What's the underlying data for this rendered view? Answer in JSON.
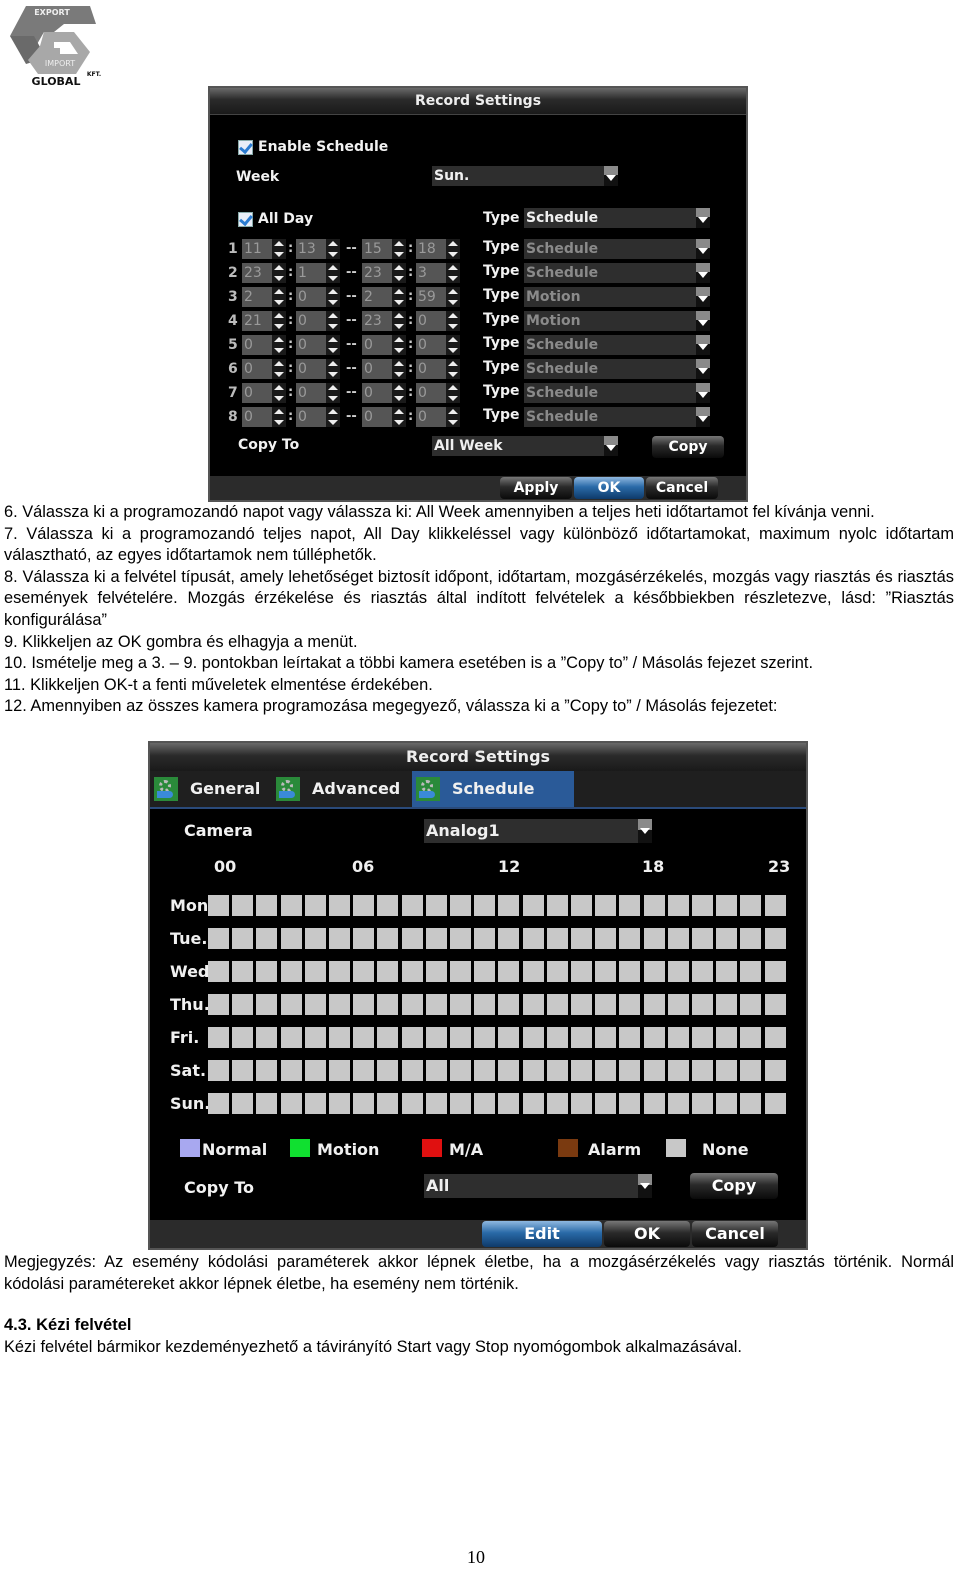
{
  "logo": {
    "top_text": "EXPORT",
    "mid_text": "IMPORT",
    "brand": "GLOBAL",
    "suffix": "KFT."
  },
  "panel1": {
    "title": "Record Settings",
    "enable_schedule": {
      "label": "Enable Schedule",
      "checked": true
    },
    "week": {
      "label": "Week",
      "value": "Sun."
    },
    "all_day": {
      "label": "All Day",
      "checked": true
    },
    "type_label": "Type",
    "all_day_type": "Schedule",
    "rows": [
      {
        "num": "1",
        "start_h": "11",
        "start_m": "13",
        "end_h": "15",
        "end_m": "18",
        "type": "Schedule"
      },
      {
        "num": "2",
        "start_h": "23",
        "start_m": "1",
        "end_h": "23",
        "end_m": "3",
        "type": "Schedule"
      },
      {
        "num": "3",
        "start_h": "2",
        "start_m": "0",
        "end_h": "2",
        "end_m": "59",
        "type": "Motion"
      },
      {
        "num": "4",
        "start_h": "21",
        "start_m": "0",
        "end_h": "23",
        "end_m": "0",
        "type": "Motion"
      },
      {
        "num": "5",
        "start_h": "0",
        "start_m": "0",
        "end_h": "0",
        "end_m": "0",
        "type": "Schedule"
      },
      {
        "num": "6",
        "start_h": "0",
        "start_m": "0",
        "end_h": "0",
        "end_m": "0",
        "type": "Schedule"
      },
      {
        "num": "7",
        "start_h": "0",
        "start_m": "0",
        "end_h": "0",
        "end_m": "0",
        "type": "Schedule"
      },
      {
        "num": "8",
        "start_h": "0",
        "start_m": "0",
        "end_h": "0",
        "end_m": "0",
        "type": "Schedule"
      }
    ],
    "colon": ":",
    "dash": "--",
    "copy_to": {
      "label": "Copy To",
      "value": "All Week",
      "button": "Copy"
    },
    "buttons": {
      "apply": "Apply",
      "ok": "OK",
      "cancel": "Cancel"
    }
  },
  "text_block_1": [
    "6. Válassza ki a programozandó napot vagy válassza ki: All Week amennyiben a teljes heti időtartamot fel kívánja venni.",
    "7. Válassza ki a programozandó teljes napot, All Day klikkeléssel vagy különböző időtartamokat, maximum nyolc időtartam választható, az egyes időtartamok nem túlléphetők.",
    "8. Válassza ki a felvétel típusát, amely lehetőséget biztosít időpont, időtartam, mozgásérzékelés, mozgás vagy riasztás és riasztás események felvételére. Mozgás érzékelése és riasztás által indított felvételek a későbbiekben részletezve, lásd: ”Riasztás konfigurálása”",
    "9. Klikkeljen az OK gombra és elhagyja a menüt.",
    "10. Ismételje meg a 3. – 9. pontokban leírtakat a többi kamera esetében is a ”Copy to” / Másolás fejezet szerint.",
    "11. Klikkeljen OK-t a fenti műveletek elmentése érdekében.",
    "12. Amennyiben az összes kamera programozása megegyező, válassza ki a ”Copy to” / Másolás fejezetet:"
  ],
  "panel2": {
    "title": "Record Settings",
    "tabs": [
      {
        "label": "General",
        "active": false
      },
      {
        "label": "Advanced",
        "active": false
      },
      {
        "label": "Schedule",
        "active": true
      }
    ],
    "camera": {
      "label": "Camera",
      "value": "Analog1"
    },
    "hour_labels": [
      "00",
      "06",
      "12",
      "18",
      "23"
    ],
    "days": [
      "Mon.",
      "Tue.",
      "Wed",
      "Thu.",
      "Fri.",
      "Sat.",
      "Sun."
    ],
    "hours_per_day": 24,
    "cell_state": "None",
    "legend": [
      {
        "label": "Normal",
        "color": "#a8a8f0"
      },
      {
        "label": "Motion",
        "color": "#10e030"
      },
      {
        "label": "M/A",
        "color": "#e01010"
      },
      {
        "label": "Alarm",
        "color": "#7a3a10"
      },
      {
        "label": "None",
        "color": "#c8c8c8"
      }
    ],
    "copy_to": {
      "label": "Copy To",
      "value": "All",
      "button": "Copy"
    },
    "buttons": {
      "edit": "Edit",
      "ok": "OK",
      "cancel": "Cancel"
    }
  },
  "note": "Megjegyzés: Az esemény kódolási paraméterek akkor lépnek életbe, ha a mozgásérzékelés vagy riasztás történik. Normál kódolási paramétereket akkor lépnek életbe, ha esemény nem történik.",
  "section": {
    "heading": "4.3. Kézi felvétel",
    "body": "Kézi felvétel bármikor kezdeményezhető a távirányító Start vagy Stop nyomógombok alkalmazásával."
  },
  "page_number": "10"
}
